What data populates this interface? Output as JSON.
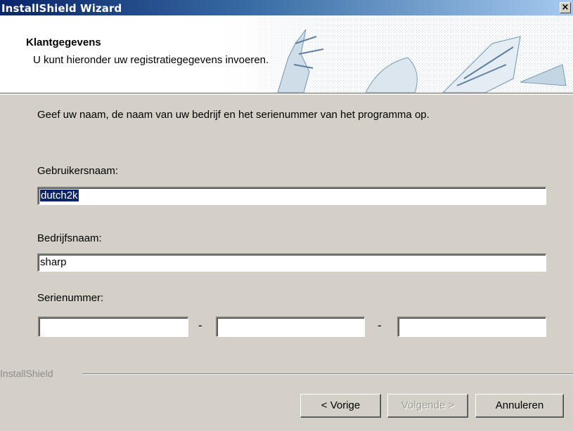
{
  "window": {
    "title": "InstallShield Wizard",
    "close_glyph": "×"
  },
  "header": {
    "title": "Klantgegevens",
    "subtitle": "U kunt hieronder uw registratiegegevens invoeren."
  },
  "content": {
    "instruction": "Geef uw naam, de naam van uw bedrijf en het serienummer van het programma op.",
    "user_label": "Gebruikersnaam:",
    "user_value": "dutch2k",
    "company_label": "Bedrijfsnaam:",
    "company_value": "sharp",
    "serial_label": "Serienummer:",
    "serial_values": [
      "",
      "",
      ""
    ],
    "serial_separator": "-"
  },
  "footer": {
    "brand": "InstallShield",
    "back_label": "< Vorige",
    "next_label": "Volgende >",
    "cancel_label": "Annuleren"
  },
  "colors": {
    "titlebar_start": "#0a246a",
    "titlebar_end": "#a6caf0",
    "dialog_bg": "#d4d0c8",
    "selection": "#0a246a"
  },
  "icons": {
    "close": "close-icon",
    "banner": "banner-artwork"
  }
}
